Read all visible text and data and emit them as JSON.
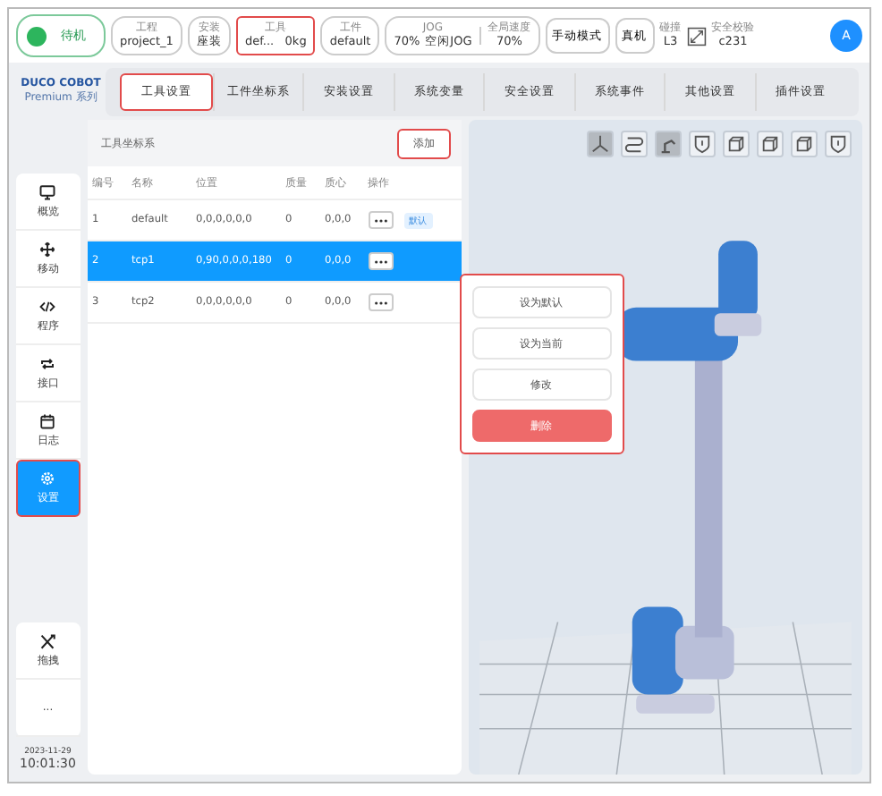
{
  "status": {
    "label": "待机",
    "color": "#2db55d"
  },
  "top_items": [
    {
      "label": "工程",
      "value": "project_1",
      "highlighted": false
    },
    {
      "label": "安装",
      "value": "座装",
      "highlighted": false
    },
    {
      "label": "工具",
      "value": "def...   0kg",
      "highlighted": true
    },
    {
      "label": "工件",
      "value": "default",
      "highlighted": false
    }
  ],
  "jog": {
    "label": "JOG",
    "speed": "70%",
    "mode": "空闲JOG",
    "global_label": "全局速度",
    "global_value": "70%"
  },
  "mode_buttons": [
    "手动模式",
    "真机"
  ],
  "collision": {
    "label": "碰撞",
    "value": "L3"
  },
  "safety": {
    "label": "安全校验",
    "value": "c231"
  },
  "avatar": "A",
  "logo": {
    "title": "DUCO COBOT",
    "subtitle": "Premium 系列"
  },
  "tabs": [
    {
      "label": "工具设置",
      "selected": true
    },
    {
      "label": "工件坐标系",
      "selected": false
    },
    {
      "label": "安装设置",
      "selected": false
    },
    {
      "label": "系统变量",
      "selected": false
    },
    {
      "label": "安全设置",
      "selected": false
    },
    {
      "label": "系统事件",
      "selected": false
    },
    {
      "label": "其他设置",
      "selected": false
    },
    {
      "label": "插件设置",
      "selected": false
    }
  ],
  "sidebar": {
    "items": [
      {
        "label": "概览",
        "selected": false
      },
      {
        "label": "移动",
        "selected": false
      },
      {
        "label": "程序",
        "selected": false
      },
      {
        "label": "接口",
        "selected": false
      },
      {
        "label": "日志",
        "selected": false
      },
      {
        "label": "设置",
        "selected": true
      }
    ],
    "bottom": [
      "拖拽",
      "..."
    ],
    "date": "2023-11-29",
    "time": "10:01:30"
  },
  "panel": {
    "title": "工具坐标系",
    "add_button": "添加",
    "add_highlighted": true
  },
  "table": {
    "columns": [
      "编号",
      "名称",
      "位置",
      "质量",
      "质心",
      "操作"
    ],
    "rows": [
      {
        "cells": [
          "1",
          "default",
          "0,0,0,0,0,0",
          "0",
          "0,0,0"
        ],
        "selected": false,
        "badge": "默认"
      },
      {
        "cells": [
          "2",
          "tcp1",
          "0,90,0,0,0,180",
          "0",
          "0,0,0"
        ],
        "selected": true
      },
      {
        "cells": [
          "3",
          "tcp2",
          "0,0,0,0,0,0",
          "0",
          "0,0,0"
        ],
        "selected": false
      }
    ]
  },
  "menu": {
    "items": [
      {
        "label": "设为默认",
        "kind": "normal"
      },
      {
        "label": "设为当前",
        "kind": "normal"
      },
      {
        "label": "修改",
        "kind": "normal"
      },
      {
        "label": "删除",
        "kind": "danger"
      }
    ]
  },
  "view_tools": [
    {
      "selected": true
    },
    {
      "selected": false
    },
    {
      "selected": true
    },
    {
      "selected": false
    },
    {
      "selected": false
    },
    {
      "selected": false
    },
    {
      "selected": false
    },
    {
      "selected": false
    }
  ]
}
